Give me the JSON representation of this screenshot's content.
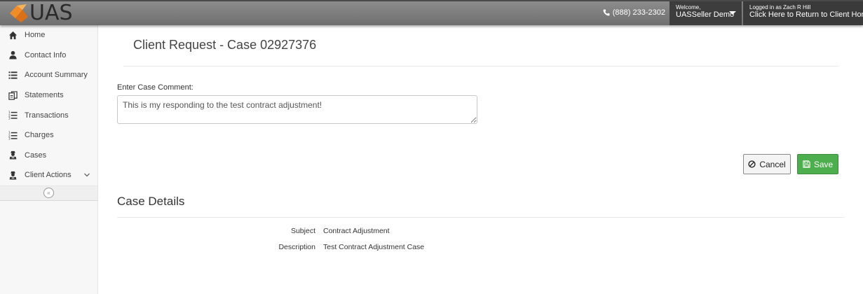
{
  "header": {
    "logo_text": "UAS",
    "phone": "(888) 233-2302",
    "welcome_label": "Welcome,",
    "welcome_name": "UASSeller Demo",
    "logged_in_label": "Logged in as Zach R Hill",
    "return_link": "Click Here to Return to Client Home",
    "brand_colors": {
      "orange": "#f28c28",
      "header_bg": "#7d7d7d",
      "dark_box": "#3d3d3d"
    }
  },
  "sidebar": {
    "items": [
      {
        "label": "Home",
        "icon": "home-icon"
      },
      {
        "label": "Contact Info",
        "icon": "user-icon"
      },
      {
        "label": "Account Summary",
        "icon": "list-icon"
      },
      {
        "label": "Statements",
        "icon": "statements-icon"
      },
      {
        "label": "Transactions",
        "icon": "numbered-list-icon"
      },
      {
        "label": "Charges",
        "icon": "numbered-list-icon"
      },
      {
        "label": "Cases",
        "icon": "agent-icon"
      },
      {
        "label": "Client Actions",
        "icon": "agent-icon",
        "expandable": true
      }
    ],
    "collapse_glyph": "«"
  },
  "main": {
    "page_title": "Client Request - Case 02927376",
    "comment_label": "Enter Case Comment:",
    "comment_value": "This is my responding to the test contract adjustment!",
    "cancel_label": "Cancel",
    "save_label": "Save",
    "save_color": "#4cae4c",
    "details": {
      "section_title": "Case Details",
      "subject_label": "Subject",
      "subject_value": "Contract Adjustment",
      "description_label": "Description",
      "description_value": "Test Contract Adjustment Case"
    }
  }
}
